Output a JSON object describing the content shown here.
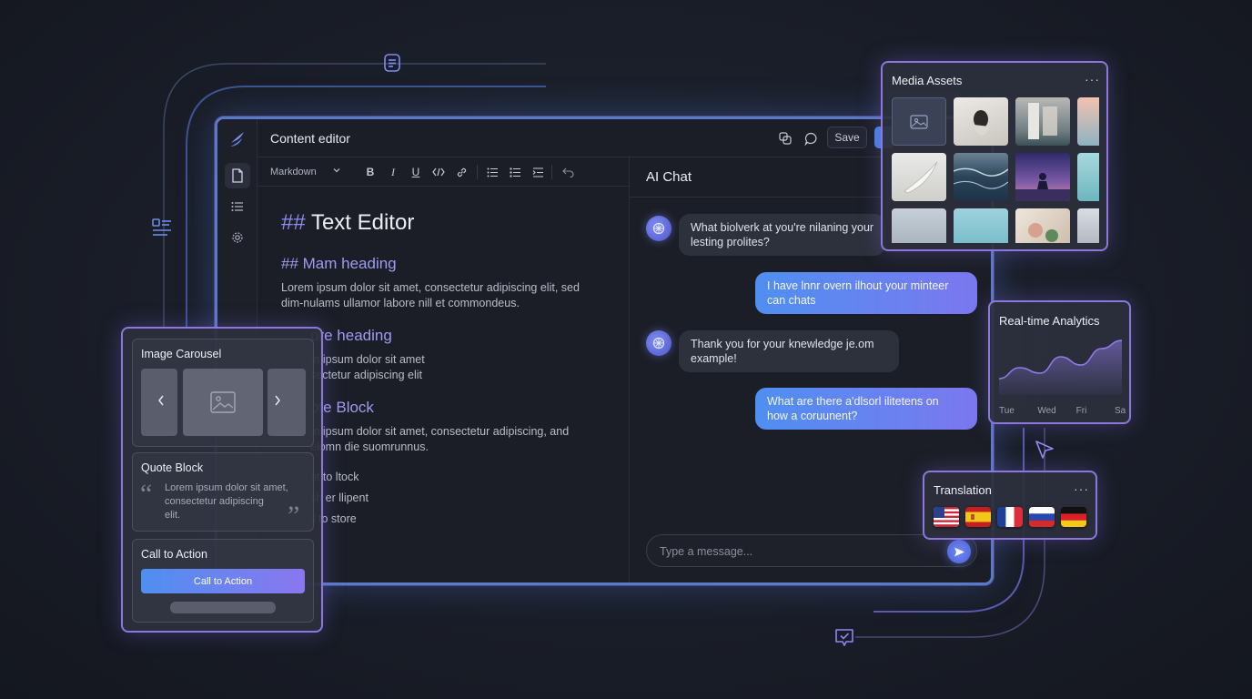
{
  "app": {
    "title": "Content editor",
    "save_label": "Save"
  },
  "toolbar": {
    "format_value": "Markdown",
    "tools": [
      "bold-icon",
      "italic-icon",
      "underline-icon",
      "code-icon",
      "link-icon",
      "bullet-list-icon",
      "numbered-list-icon",
      "indent-icon",
      "undo-icon"
    ]
  },
  "editor": {
    "h1_hash": "##",
    "h1_text": " Text Editor",
    "heading2": "## Mam heading",
    "para1_line1": "Lorem ipsum dolor sit amet, consectetur adipiscing elit, sed",
    "para1_line2": "dim-nulams ullamor labore nill et commondeus.",
    "heading3": "ore heading",
    "para2_line1": "m ipsum dolor sit amet",
    "para2_line2": "sectetur adipiscing elit",
    "heading4": "ote Block",
    "para3_line1": "m ipsum dolor sit amet, consectetur adipiscing, and",
    "para3_line2": "elomn die suomrunnus.",
    "list1": "nt to ltock",
    "list2": "sh er llipent",
    "list3": "il to store"
  },
  "chat": {
    "title": "AI Chat",
    "messages": [
      {
        "from": "ai",
        "line1": "What biolverk at you're nilaning your",
        "line2": "lesting prolites?"
      },
      {
        "from": "me",
        "line1": "I have lnnr overn ilhout your minteer",
        "line2": "can chats"
      },
      {
        "from": "ai",
        "line1": "Thank you for your knewledge je.om",
        "line2": "example!"
      },
      {
        "from": "me",
        "line1": "What are there a'dlsorl ilitetens on",
        "line2": "how a coruunent?"
      }
    ],
    "input_placeholder": "Type a message..."
  },
  "media": {
    "title": "Media Assets",
    "menu": "···"
  },
  "analytics": {
    "title": "Real-time Analytics",
    "chart_data": {
      "type": "area",
      "categories": [
        "Tue",
        "Wed",
        "Fri",
        "San"
      ],
      "series": [
        {
          "values": [
            12,
            20,
            16,
            28,
            22,
            34,
            40
          ]
        }
      ],
      "color": "#8f7be8"
    }
  },
  "translation": {
    "title": "Translation",
    "menu": "···",
    "flags": [
      "us-flag-icon",
      "spain-flag-icon",
      "france-flag-icon",
      "russia-flag-icon",
      "germany-flag-icon"
    ]
  },
  "left_panel": {
    "carousel_title": "Image Carousel",
    "quote_title": "Quote Block",
    "quote_line1": "Lorem ipsum dolor sit amet,",
    "quote_line2": "consectetur adipiscing",
    "quote_line3": "elit.",
    "cta_title": "Call to Action",
    "cta_button": "Call to Action"
  },
  "colors": {
    "accent_blue": "#4f8ff0",
    "accent_purple": "#8a77ee",
    "background": "#1b1f2a"
  }
}
